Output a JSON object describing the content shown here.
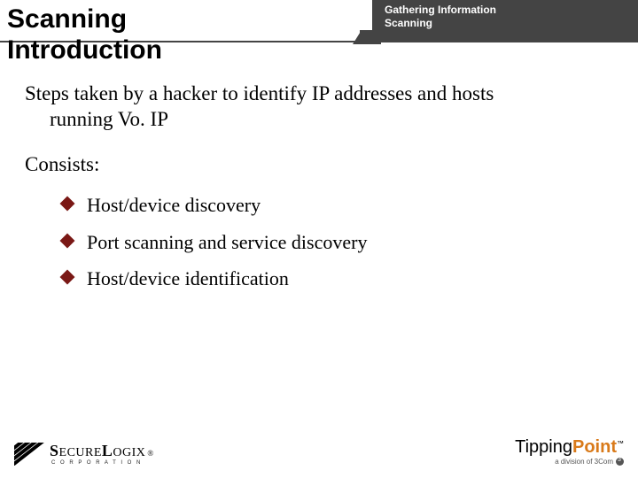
{
  "header": {
    "title_line1": "Scanning",
    "title_line2": "Introduction",
    "breadcrumb_line1": "Gathering Information",
    "breadcrumb_line2": "Scanning"
  },
  "body": {
    "lead_line1": "Steps taken by a hacker to identify IP addresses and hosts",
    "lead_line2": "running Vo. IP",
    "consists_label": "Consists:",
    "bullets": [
      "Host/device discovery",
      "Port scanning and service discovery",
      "Host/device identification"
    ]
  },
  "footer": {
    "left": {
      "word1": "S",
      "word2": "ECURE",
      "word3": "L",
      "word4": "OGIX",
      "reg": "®",
      "sub": "C  O  R  P  O  R  A  T  I  O  N"
    },
    "right": {
      "part1": "Tipping",
      "part2": "Point",
      "tm": "™",
      "sub": "a division of 3Com"
    }
  }
}
